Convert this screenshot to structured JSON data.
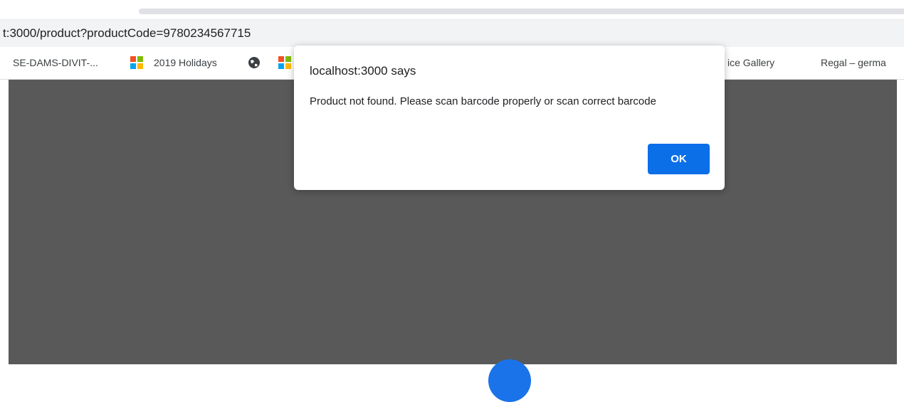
{
  "browser": {
    "url": "t:3000/product?productCode=9780234567715",
    "bookmarks": [
      {
        "label": "SE-DAMS-DIVIT-...",
        "icon": null
      },
      {
        "label": "2019 Holidays",
        "icon": "microsoft-logo-icon"
      },
      {
        "label": "",
        "icon": "globe-icon"
      },
      {
        "label": "",
        "icon": "microsoft-logo-icon"
      },
      {
        "label": "ice Gallery",
        "icon": null
      },
      {
        "label": "Regal – germa",
        "icon": null
      }
    ]
  },
  "dialog": {
    "title": "localhost:3000 says",
    "message": "Product not found. Please scan barcode properly or scan correct barcode",
    "ok_label": "OK"
  },
  "colors": {
    "page_background": "#595959",
    "ok_button": "#0b6fe8",
    "accent_circle": "#1a73e8"
  }
}
